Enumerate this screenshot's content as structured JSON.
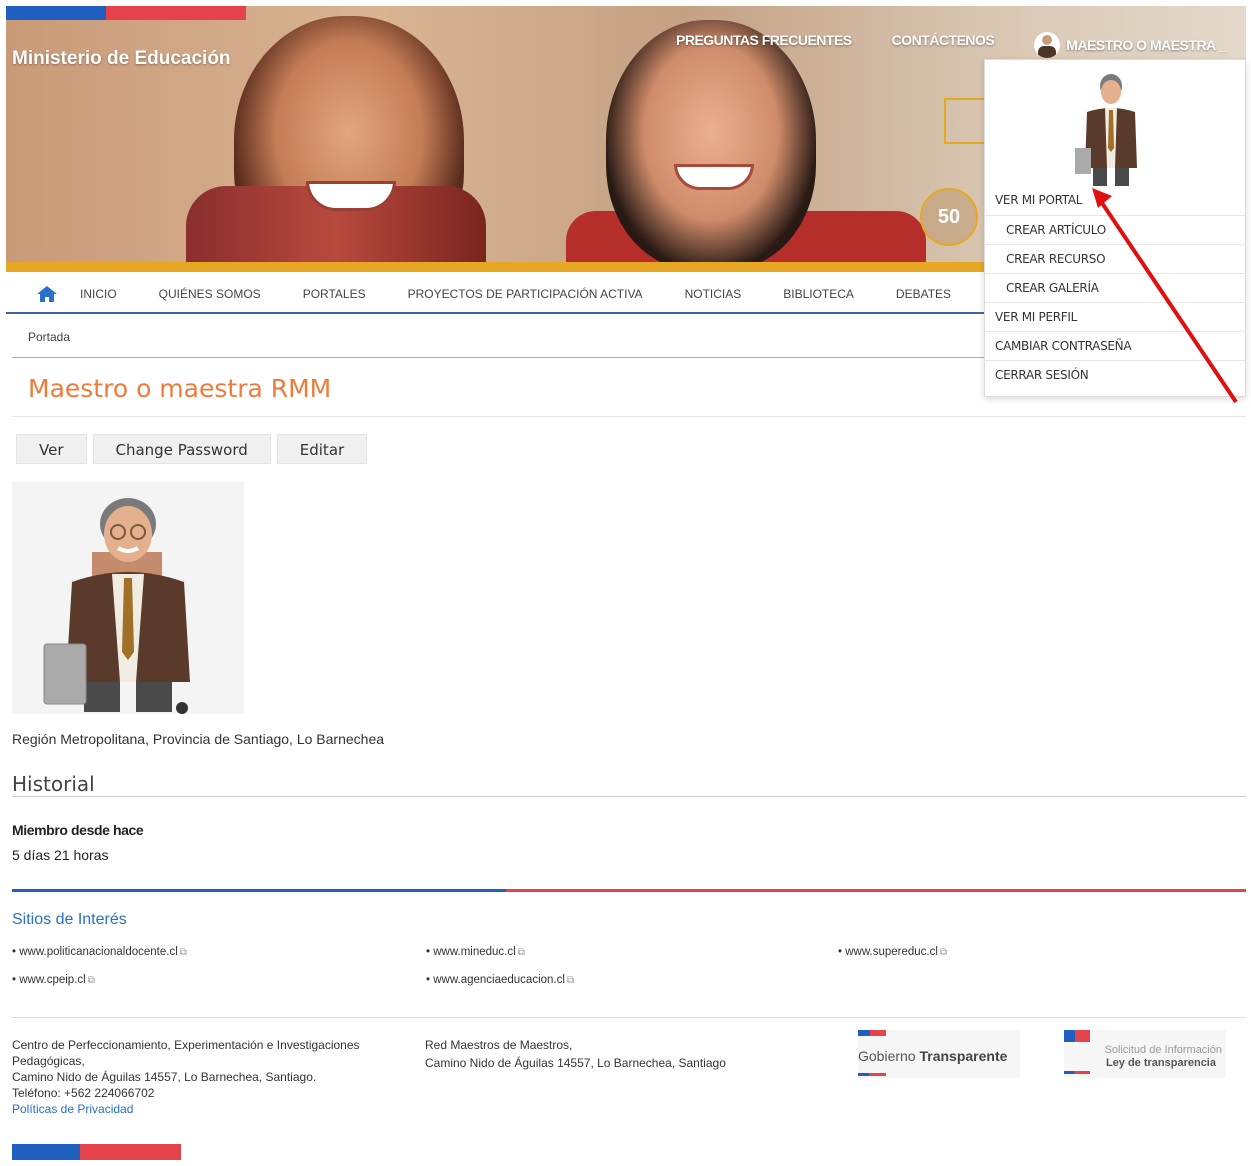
{
  "header": {
    "brand": "Ministerio de Educación",
    "nav": {
      "faq": "PREGUNTAS FRECUENTES",
      "contact": "CONTÁCTENOS",
      "user": "MAESTRO O MAESTRA _"
    },
    "badge": "50"
  },
  "user_menu": {
    "items": [
      {
        "label": "VER MI PORTAL",
        "level": 1
      },
      {
        "label": "CREAR ARTÍCULO",
        "level": 2
      },
      {
        "label": "CREAR RECURSO",
        "level": 2
      },
      {
        "label": "CREAR GALERÍA",
        "level": 2
      },
      {
        "label": "VER MI PERFIL",
        "level": 1
      },
      {
        "label": "CAMBIAR CONTRASEÑA",
        "level": 1
      },
      {
        "label": "CERRAR SESIÓN",
        "level": 1
      }
    ]
  },
  "main_nav": {
    "items": [
      "INICIO",
      "QUIÉNES SOMOS",
      "PORTALES",
      "PROYECTOS DE PARTICIPACIÓN ACTIVA",
      "NOTICIAS",
      "BIBLIOTECA",
      "DEBATES"
    ]
  },
  "breadcrumb": "Portada",
  "page": {
    "title": "Maestro o maestra RMM",
    "tabs": [
      "Ver",
      "Change Password",
      "Editar"
    ],
    "region": "Región Metropolitana, Provincia de Santiago, Lo Barnechea",
    "history_title": "Historial",
    "member_since_label": "Miembro desde hace",
    "member_since_value": "5 días 21 horas"
  },
  "footer": {
    "sites_title": "Sitios de Interés",
    "links": [
      "www.politicanacionaldocente.cl",
      "www.mineduc.cl",
      "www.supereduc.cl",
      "www.cpeip.cl",
      "www.agenciaeducacion.cl"
    ],
    "addr1": {
      "line1": "Centro de Perfeccionamiento, Experimentación e Investigaciones",
      "line2": "Pedagógicas,",
      "line3": "Camino Nido de Águilas 14557, Lo Barnechea, Santiago.",
      "line4": "Teléfono: +562 224066702",
      "privacy": "Políticas de Privacidad"
    },
    "addr2": {
      "line1": "Red Maestros de Maestros,",
      "line2": "Camino Nido de Águilas 14557, Lo Barnechea, Santiago"
    },
    "gob_light": "Gobierno",
    "gob_bold": "Transparente",
    "sol_line1": "Solicitud de Información",
    "sol_line2": "Ley de transparencia"
  },
  "colors": {
    "accent_orange": "#ef7b3a",
    "gov_blue": "#1f5fbf",
    "gov_red": "#e4434b",
    "nav_gold": "#e8a722",
    "link_blue": "#2a6fc9"
  }
}
